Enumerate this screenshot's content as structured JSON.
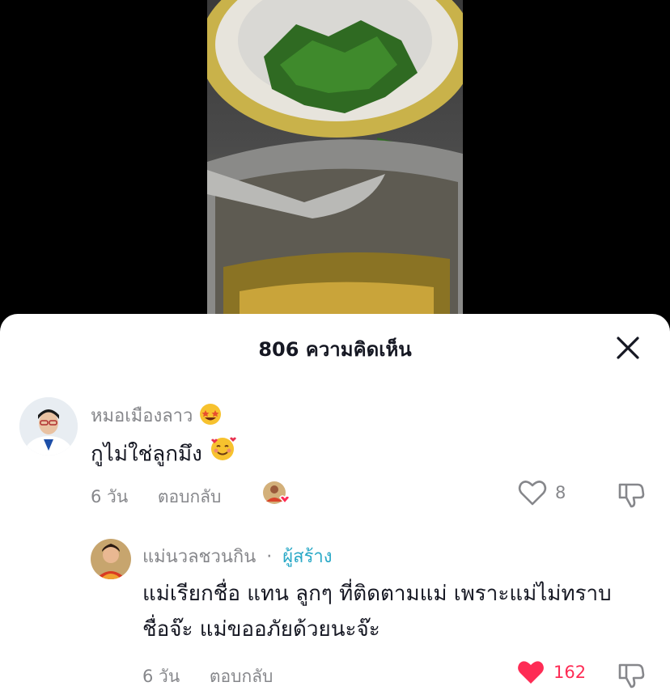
{
  "sheet": {
    "title": "806 ความคิดเห็น"
  },
  "comments": [
    {
      "username": "หมอเมืองลาว",
      "username_emoji": "star-struck-emoji",
      "text": "กูไม่ใช่ลูกมึง",
      "text_emoji": "smiling-face-with-hearts-emoji",
      "time": "6 วัน",
      "reply_label": "ตอบกลับ",
      "likes": "8",
      "liked": false
    },
    {
      "username": "แม่นวลชวนกิน",
      "separator": "·",
      "creator_label": "ผู้สร้าง",
      "text_line1": "แม่เรียกชื่อ แทน ลูกๆ ที่ติดตามแม่ เพราะแม่ไม่ทราบ",
      "text_line2": "ชื่อจ๊ะ แม่ขออภัยด้วยนะจ๊ะ",
      "time": "6 วัน",
      "reply_label": "ตอบกลับ",
      "likes": "162",
      "liked": true
    }
  ],
  "colors": {
    "like_active": "#fe2c55",
    "creator": "#2aa9c7",
    "muted": "#86878b"
  }
}
